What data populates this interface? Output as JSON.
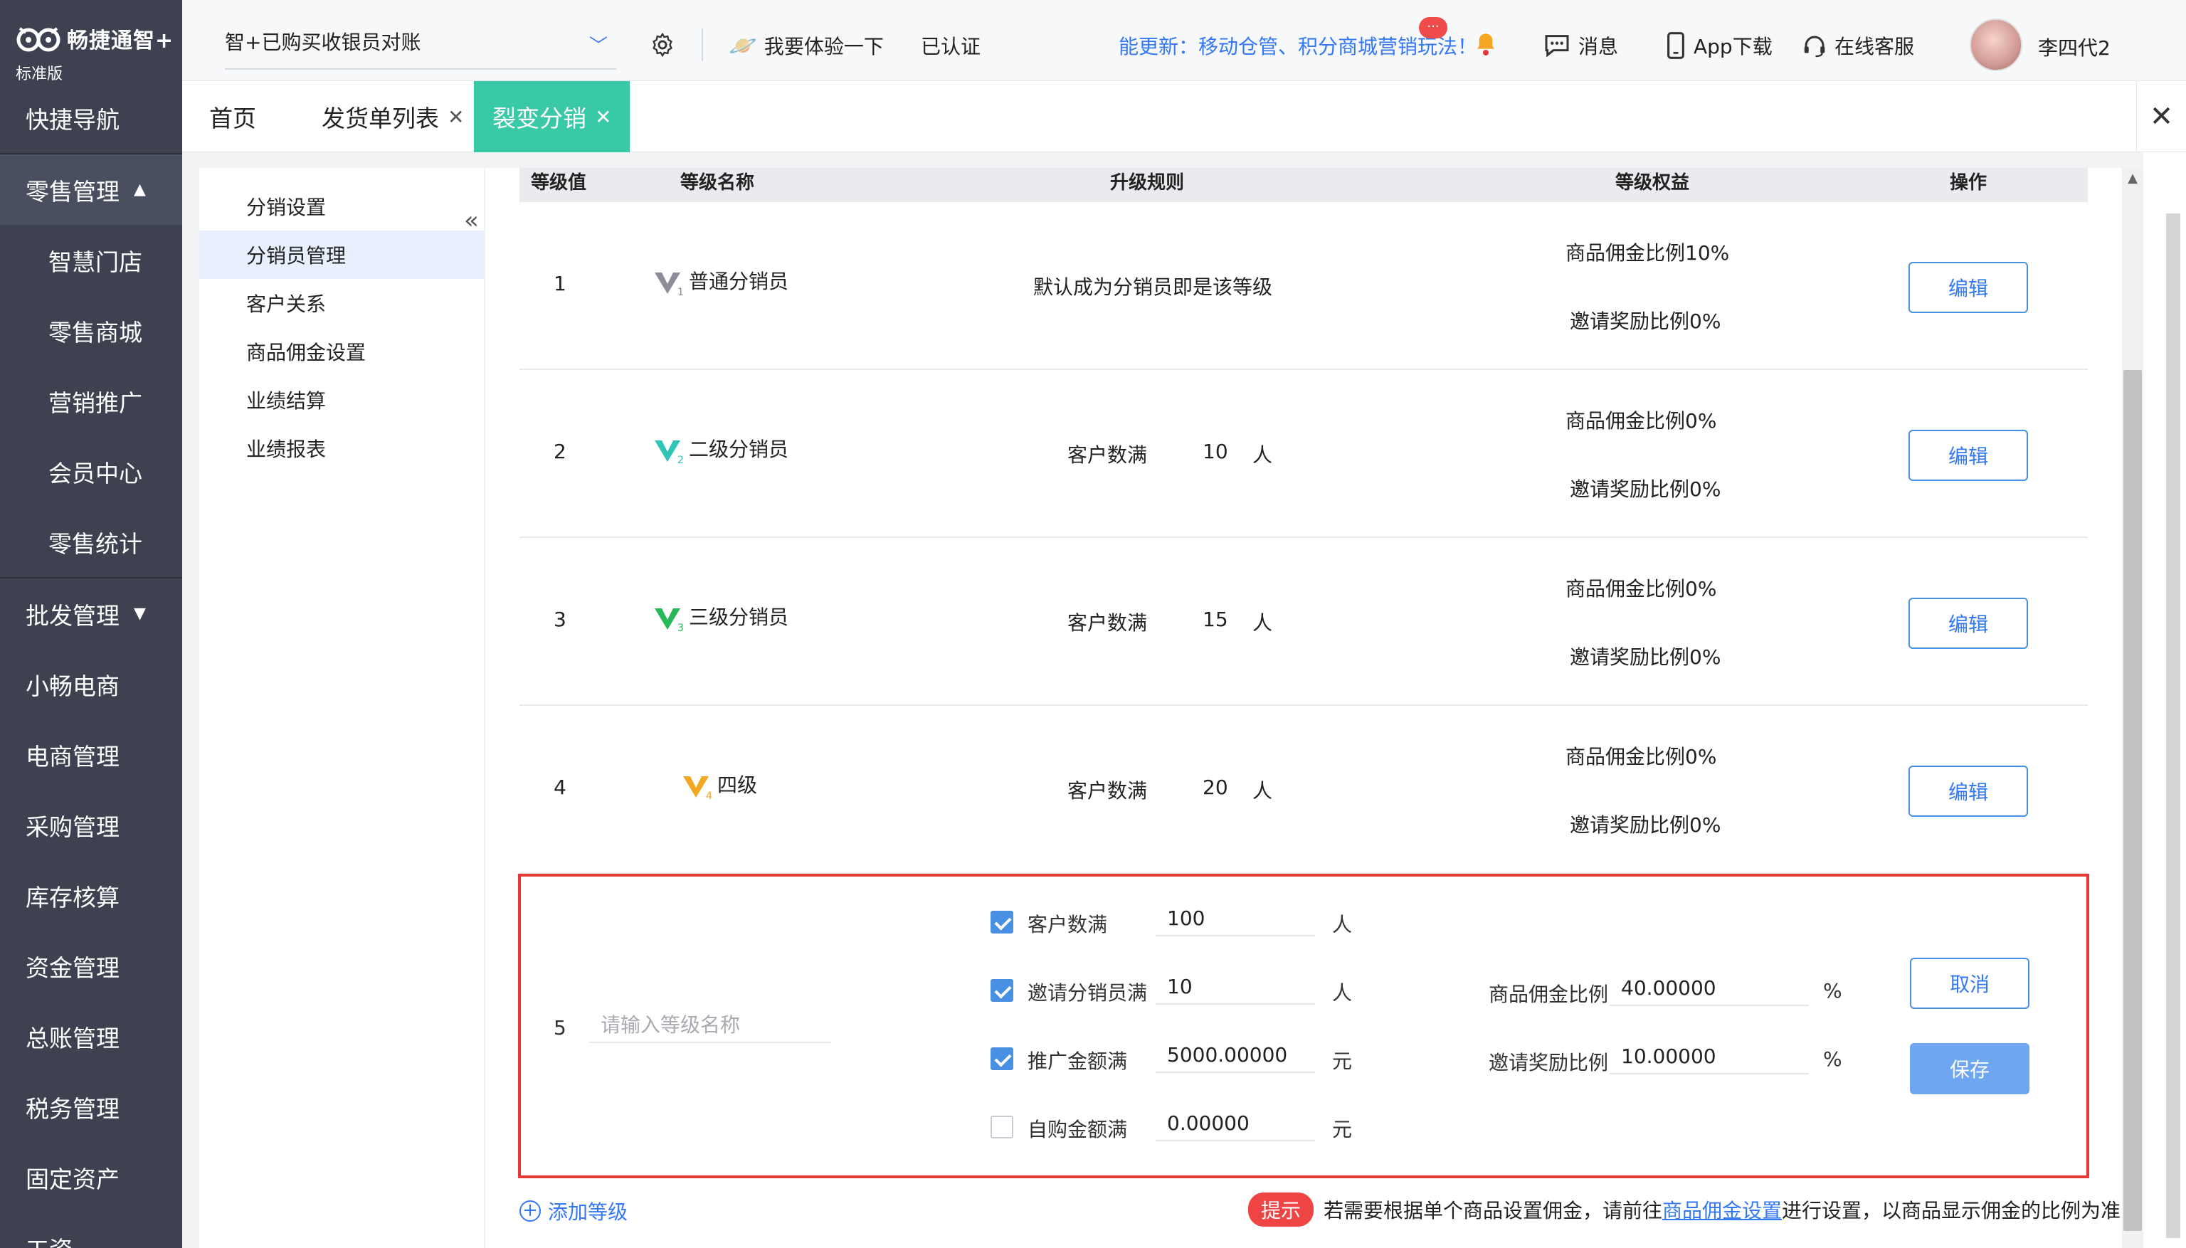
{
  "sidebar": {
    "logo_text": "畅捷通智+",
    "logo_sub": "标准版",
    "items": [
      {
        "label": "快捷导航",
        "type": "top"
      },
      {
        "label": "零售管理",
        "type": "group",
        "caret": "▲"
      },
      {
        "label": "智慧门店",
        "type": "sub"
      },
      {
        "label": "零售商城",
        "type": "sub"
      },
      {
        "label": "营销推广",
        "type": "sub"
      },
      {
        "label": "会员中心",
        "type": "sub"
      },
      {
        "label": "零售统计",
        "type": "sub"
      },
      {
        "label": "批发管理",
        "type": "top",
        "caret": "▼"
      },
      {
        "label": "小畅电商",
        "type": "top"
      },
      {
        "label": "电商管理",
        "type": "top"
      },
      {
        "label": "采购管理",
        "type": "top"
      },
      {
        "label": "库存核算",
        "type": "top"
      },
      {
        "label": "资金管理",
        "type": "top"
      },
      {
        "label": "总账管理",
        "type": "top"
      },
      {
        "label": "税务管理",
        "type": "top"
      },
      {
        "label": "固定资产",
        "type": "top"
      },
      {
        "label": "工资",
        "type": "top"
      }
    ]
  },
  "header": {
    "company": "智+已购买收银员对账",
    "trial": "我要体验一下",
    "certified": "已认证",
    "news": "能更新：移动仓管、积分商城营销玩法！",
    "messages": "消息",
    "message_badge": "···",
    "app": "App下载",
    "service": "在线客服",
    "user": "李四代2"
  },
  "tabs": [
    {
      "label": "首页",
      "closable": false
    },
    {
      "label": "发货单列表",
      "closable": true
    },
    {
      "label": "裂变分销",
      "closable": true,
      "active": true
    }
  ],
  "tabs_close_all": "✕",
  "subnav": {
    "items": [
      "分销设置",
      "分销员管理",
      "客户关系",
      "商品佣金设置",
      "业绩结算",
      "业绩报表"
    ],
    "active_index": 1,
    "collapse": "«"
  },
  "table": {
    "headers": [
      "等级值",
      "等级名称",
      "升级规则",
      "等级权益",
      "操作"
    ],
    "rows": [
      {
        "level": "1",
        "name": "普通分销员",
        "rule": "默认成为分销员即是该等级",
        "rule_count": "",
        "rule_unit": "",
        "benefit_commission": "商品佣金比例10%",
        "benefit_invite": "邀请奖励比例0%",
        "action": "编辑",
        "icon_color": "#8c8c9a",
        "icon_sub": "1"
      },
      {
        "level": "2",
        "name": "二级分销员",
        "rule": "客户数满",
        "rule_count": "10",
        "rule_unit": "人",
        "benefit_commission": "商品佣金比例0%",
        "benefit_invite": "邀请奖励比例0%",
        "action": "编辑",
        "icon_color": "#2ec4b6",
        "icon_sub": "2"
      },
      {
        "level": "3",
        "name": "三级分销员",
        "rule": "客户数满",
        "rule_count": "15",
        "rule_unit": "人",
        "benefit_commission": "商品佣金比例0%",
        "benefit_invite": "邀请奖励比例0%",
        "action": "编辑",
        "icon_color": "#27b85a",
        "icon_sub": "3"
      },
      {
        "level": "4",
        "name": "四级",
        "rule": "客户数满",
        "rule_count": "20",
        "rule_unit": "人",
        "benefit_commission": "商品佣金比例0%",
        "benefit_invite": "邀请奖励比例0%",
        "action": "编辑",
        "icon_color": "#f5a623",
        "icon_sub": "4"
      }
    ]
  },
  "edit_row": {
    "level": "5",
    "name_placeholder": "请输入等级名称",
    "conditions": [
      {
        "label": "客户数满",
        "value": "100",
        "unit": "人",
        "checked": true
      },
      {
        "label": "邀请分销员满",
        "value": "10",
        "unit": "人",
        "checked": true
      },
      {
        "label": "推广金额满",
        "value": "5000.00000",
        "unit": "元",
        "checked": true
      },
      {
        "label": "自购金额满",
        "value": "0.00000",
        "unit": "元",
        "checked": false
      }
    ],
    "commission_label": "商品佣金比例",
    "commission_value": "40.00000",
    "commission_unit": "%",
    "invite_label": "邀请奖励比例",
    "invite_value": "10.00000",
    "invite_unit": "%",
    "cancel": "取消",
    "save": "保存"
  },
  "footer": {
    "add_level": "添加等级",
    "tip_tag": "提示",
    "tip_before": "若需要根据单个商品设置佣金，请前往",
    "tip_link": "商品佣金设置",
    "tip_after": "进行设置，以商品显示佣金的比例为准"
  }
}
